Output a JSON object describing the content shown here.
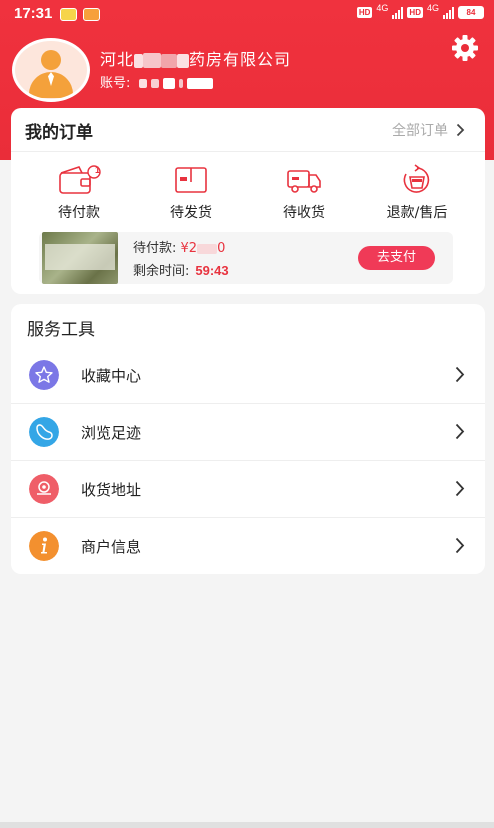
{
  "status_bar": {
    "time": "17:31",
    "hd1": "HD",
    "net1": "4G",
    "hd2": "HD",
    "net2": "4G",
    "battery": "84"
  },
  "profile": {
    "name_prefix": "河北",
    "name_suffix": "药房有限公司",
    "account_label": "账号:"
  },
  "orders": {
    "title": "我的订单",
    "all_label": "全部订单",
    "items": [
      {
        "label": "待付款",
        "badge": "1",
        "icon": "wallet-icon"
      },
      {
        "label": "待发货",
        "icon": "package-icon"
      },
      {
        "label": "待收货",
        "icon": "truck-icon"
      },
      {
        "label": "退款/售后",
        "icon": "refund-icon"
      }
    ],
    "pending": {
      "label": "待付款:",
      "amount_prefix": "¥2",
      "amount_suffix": "0",
      "time_label": "剩余时间:",
      "time_value": "59:43",
      "pay_button": "去支付"
    }
  },
  "tools": {
    "title": "服务工具",
    "items": [
      {
        "label": "收藏中心",
        "icon": "star-icon",
        "color": "#7b77e6"
      },
      {
        "label": "浏览足迹",
        "icon": "footprint-icon",
        "color": "#34a6e6"
      },
      {
        "label": "收货地址",
        "icon": "location-icon",
        "color": "#ef5e68"
      },
      {
        "label": "商户信息",
        "icon": "info-icon",
        "color": "#f3902f"
      }
    ]
  },
  "colors": {
    "brand_red": "#ea2d39",
    "pay_button": "#f03a57",
    "price_red": "#e8333f"
  }
}
